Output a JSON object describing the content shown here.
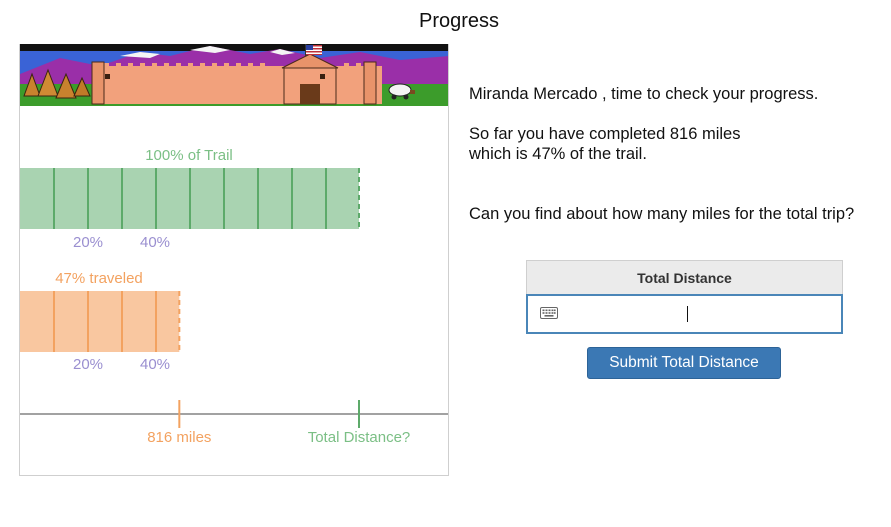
{
  "page": {
    "title": "Progress"
  },
  "message": {
    "greeting": "Miranda Mercado , time to check your progress.",
    "completed_line1": "So far you have completed 816 miles",
    "completed_line2": "which is 47% of the trail.",
    "question": "Can you find about how many miles for the total trip?"
  },
  "diagram": {
    "trail_bar": {
      "label": "100% of Trail",
      "color": "#a9d3b1",
      "line_color": "#5daa6a",
      "tick_labels": [
        "20%",
        "40%"
      ],
      "fraction": 1.0
    },
    "traveled_bar": {
      "label": "47% traveled",
      "color": "#f9c7a0",
      "line_color": "#f3a260",
      "tick_labels": [
        "20%",
        "40%"
      ],
      "fraction": 0.47
    },
    "tick_label_color": "#9a8fd0",
    "axis": {
      "traveled_label": "816 miles",
      "total_label": "Total Distance?"
    }
  },
  "answer": {
    "header": "Total Distance",
    "input_value": "",
    "input_placeholder": "",
    "icon": "keyboard-icon"
  },
  "submit": {
    "label": "Submit Total Distance",
    "color": "#3b78b4"
  }
}
